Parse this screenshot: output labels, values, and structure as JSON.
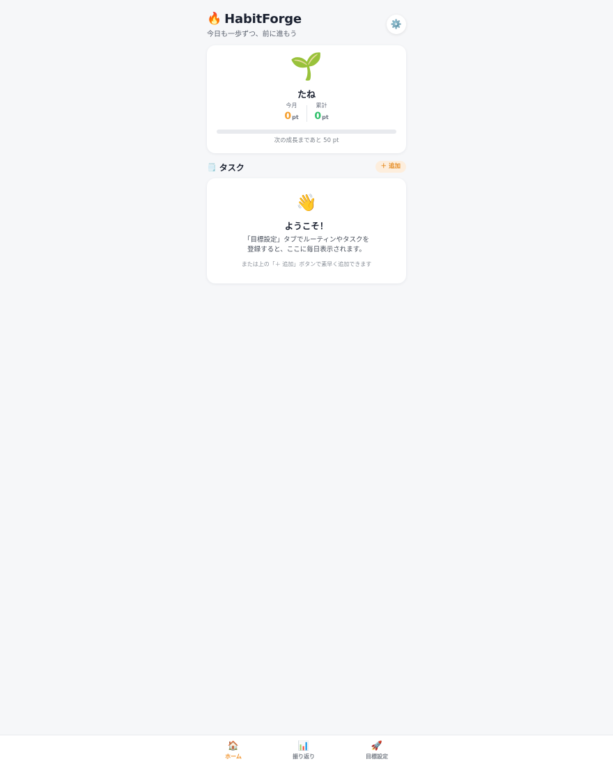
{
  "header": {
    "emoji": "🔥",
    "title": "HabitForge",
    "subtitle": "今日も一歩ずつ、前に進もう",
    "settings_icon": "⚙️"
  },
  "status": {
    "plant_emoji": "🌱",
    "stage_name": "たね",
    "month_label": "今月",
    "month_points": "0",
    "total_label": "累計",
    "total_points": "0",
    "unit": "pt",
    "progress": 0,
    "next_growth_text": "次の成長まであと 50 pt",
    "colors": {
      "month": "#f59e2b",
      "total": "#2fc06a"
    }
  },
  "tasks": {
    "icon": "🗒️",
    "title": "タスク",
    "add_label": "＋ 追加",
    "welcome": {
      "emoji": "👋",
      "title": "ようこそ！",
      "line1": "「目標設定」タブでルーティンやタスクを",
      "line2": "登録すると、ここに毎日表示されます。",
      "hint": "または上の「＋ 追加」ボタンで素早く追加できます"
    }
  },
  "nav": {
    "items": [
      {
        "icon": "🏠",
        "label": "ホーム",
        "active": true
      },
      {
        "icon": "📊",
        "label": "振り返り",
        "active": false
      },
      {
        "icon": "🚀",
        "label": "目標設定",
        "active": false
      }
    ],
    "accent": "#f08c1e"
  }
}
